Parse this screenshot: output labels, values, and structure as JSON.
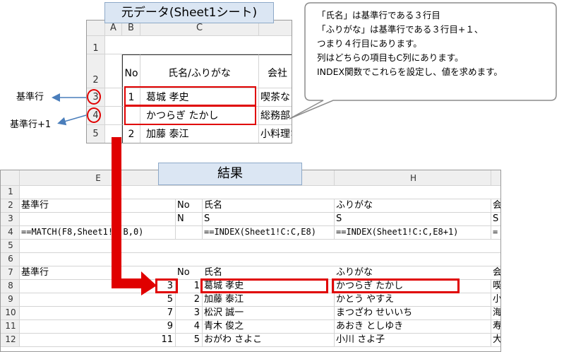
{
  "top_title": "元データ(Sheet1シート)",
  "result_title": "結果",
  "side_labels": {
    "base_row": "基準行",
    "base_row_plus1": "基準行+1"
  },
  "callout_lines": [
    "「氏名」は基準行である３行目",
    "「ふりがな」は基準行である３行目+１、",
    "つまり４行目にあります。",
    "列はどちらの項目もC列にあります。",
    "INDEX関数でこれらを設定し、値を求めます。"
  ],
  "top_sheet": {
    "columns": [
      "A",
      "B",
      "C"
    ],
    "rows": [
      "1",
      "2",
      "3",
      "4",
      "5"
    ],
    "header_no": "No",
    "header_name": "氏名/ふりがな",
    "header_company": "会社",
    "r3_no": "1",
    "r3_name": "葛城 孝史",
    "r3_company": "喫茶な",
    "r4_name": "かつらぎ たかし",
    "r4_company": "総務部",
    "r5_no": "2",
    "r5_name": "加藤 泰江",
    "r5_company": "小料理な"
  },
  "bottom_sheet": {
    "col_E": "E",
    "col_H": "H",
    "row_numbers": [
      "1",
      "2",
      "3",
      "4",
      "5",
      "6",
      "7",
      "8",
      "9",
      "10",
      "11",
      "12"
    ],
    "r2": {
      "E": "基準行",
      "F": "No",
      "G": "氏名",
      "H": "ふりがな",
      "I": "会"
    },
    "r3": {
      "F": "N",
      "G": "S",
      "H": "S",
      "I": "S"
    },
    "r4": {
      "E": "==MATCH(F8,Sheet1!B:B,0)",
      "G": "==INDEX(Sheet1!C:C,E8)",
      "H": "==INDEX(Sheet1!C:C,E8+1)",
      "I": "="
    },
    "r7": {
      "E": "基準行",
      "F": "No",
      "G": "氏名",
      "H": "ふりがな",
      "I": "会"
    },
    "data": [
      {
        "E": "3",
        "F": "1",
        "G": "葛城 孝史",
        "H": "かつらぎ たかし",
        "I": "喫"
      },
      {
        "E": "5",
        "F": "2",
        "G": "加藤 泰江",
        "H": "かとう やすえ",
        "I": "小"
      },
      {
        "E": "7",
        "F": "3",
        "G": "松沢 誠一",
        "H": "まつざわ せいいち",
        "I": "海"
      },
      {
        "E": "9",
        "F": "4",
        "G": "青木 俊之",
        "H": "あおき としゆき",
        "I": "寿"
      },
      {
        "E": "11",
        "F": "5",
        "G": "おがわ さよこ",
        "H": "小川 さよ子",
        "I": "大"
      }
    ]
  },
  "colors": {
    "red": "#e00000",
    "arrow_blue": "#4a7ebb",
    "tab_fill": "#dbe6f3",
    "header_gray": "#efefef"
  }
}
